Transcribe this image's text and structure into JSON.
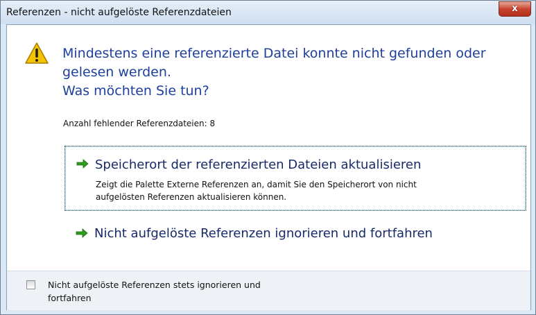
{
  "window": {
    "title": "Referenzen - nicht aufgelöste Referenzdateien",
    "close_glyph": "x"
  },
  "message": {
    "line1": "Mindestens eine referenzierte Datei konnte nicht gefunden oder",
    "line2": "gelesen werden.",
    "question": "Was möchten Sie tun?",
    "icon": "warning-icon"
  },
  "missing_count_label": "Anzahl fehlender Referenzdateien: 8",
  "options": [
    {
      "icon": "arrow-right-icon",
      "title": "Speicherort der referenzierten Dateien aktualisieren",
      "desc_line1": "Zeigt die Palette Externe Referenzen an, damit Sie den Speicherort von nicht",
      "desc_line2": "aufgelösten Referenzen aktualisieren können."
    },
    {
      "icon": "arrow-right-icon",
      "title": "Nicht aufgelöste Referenzen ignorieren und fortfahren"
    }
  ],
  "footer": {
    "checkbox_line1": "Nicht aufgelöste Referenzen stets ignorieren und",
    "checkbox_line2": "fortfahren",
    "checked": false
  },
  "colors": {
    "headline": "#1d3f9e",
    "option_title": "#162a6b",
    "arrow": "#2e9b1f",
    "warning": "#f5c400"
  }
}
